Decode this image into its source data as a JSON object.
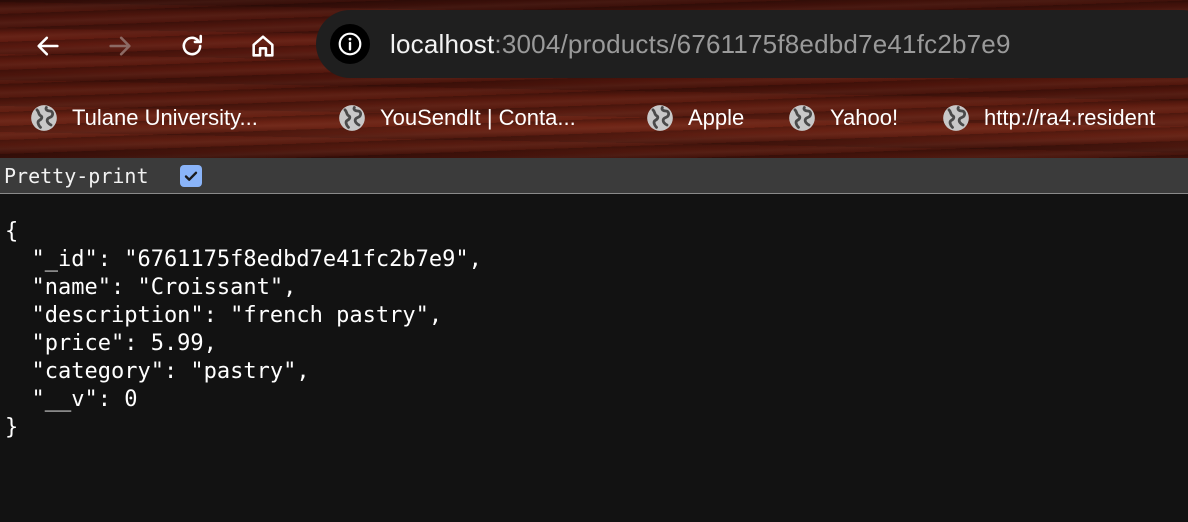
{
  "browser": {
    "url_host": "localhost",
    "url_rest": ":3004/products/6761175f8edbd7e41fc2b7e9",
    "icons": {
      "back": "arrow-left-icon",
      "forward": "arrow-right-icon",
      "reload": "reload-icon",
      "home": "home-icon",
      "site_info": "info-icon",
      "bookmark": "globe-icon"
    },
    "bookmarks": [
      {
        "label": "Tulane University..."
      },
      {
        "label": "YouSendIt | Conta..."
      },
      {
        "label": "Apple"
      },
      {
        "label": "Yahoo!"
      },
      {
        "label": "http://ra4.resident"
      }
    ]
  },
  "viewer": {
    "pretty_print_label": "Pretty-print",
    "pretty_print_checked": true,
    "json_lines": [
      "{",
      "  \"_id\": \"6761175f8edbd7e41fc2b7e9\",",
      "  \"name\": \"Croissant\",",
      "  \"description\": \"french pastry\",",
      "  \"price\": 5.99,",
      "  \"category\": \"pastry\",",
      "  \"__v\": 0",
      "}"
    ]
  },
  "colors": {
    "checkbox_accent": "#8ab4f8",
    "viewer_bg": "#121212",
    "omnibox_bg": "#1f1f1f"
  }
}
